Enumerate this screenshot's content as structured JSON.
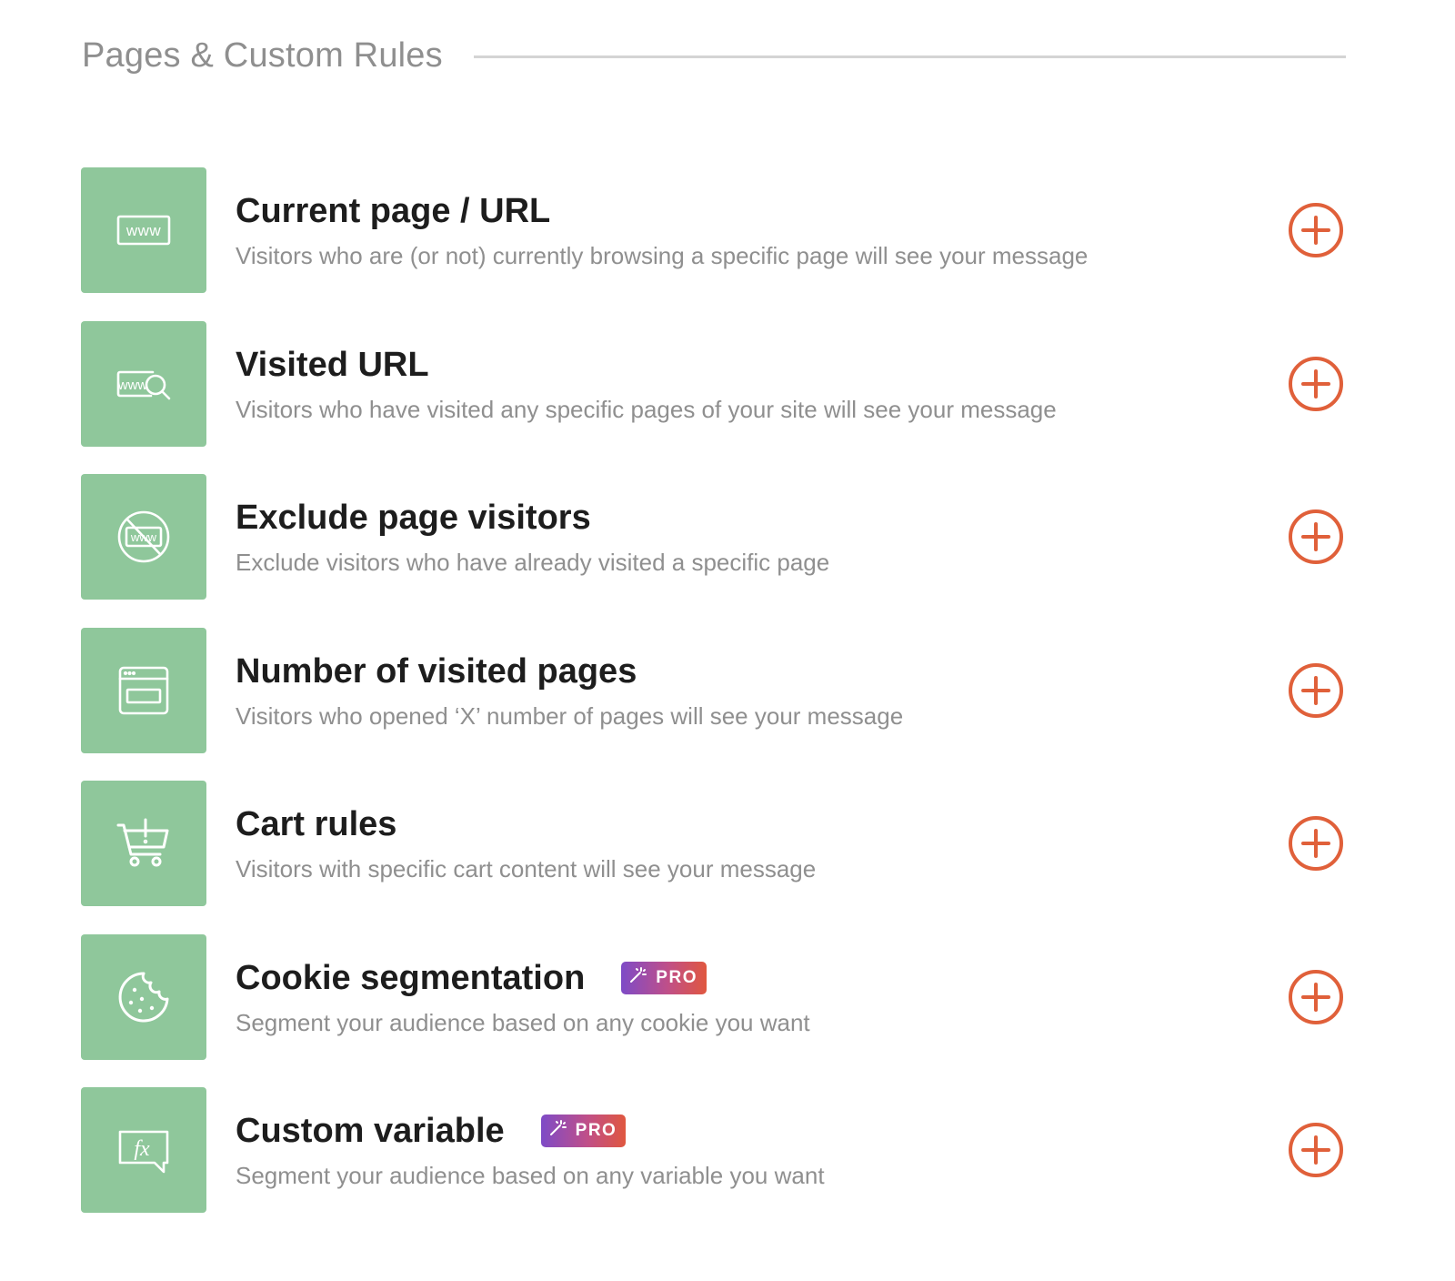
{
  "section": {
    "title": "Pages & Custom Rules"
  },
  "colors": {
    "icon_tile": "#8fc79b",
    "add_button": "#e0603a",
    "pro_badge_start": "#7e4bc7",
    "pro_badge_end": "#e0573f"
  },
  "rules": [
    {
      "title": "Current page / URL",
      "description": "Visitors who are (or not) currently browsing a specific page will see your message",
      "icon": "www-icon",
      "pro": false
    },
    {
      "title": "Visited URL",
      "description": "Visitors who have visited any specific pages of your site will see your message",
      "icon": "www-search-icon",
      "pro": false
    },
    {
      "title": "Exclude page visitors",
      "description": "Exclude visitors who have already visited a specific page",
      "icon": "www-blocked-icon",
      "pro": false
    },
    {
      "title": "Number of visited pages",
      "description": "Visitors who opened ‘X’ number of pages will see your message",
      "icon": "browser-window-icon",
      "pro": false
    },
    {
      "title": "Cart rules",
      "description": "Visitors with specific cart content will see your message",
      "icon": "cart-alert-icon",
      "pro": false
    },
    {
      "title": "Cookie segmentation",
      "description": "Segment your audience based on any cookie you want",
      "icon": "cookie-icon",
      "pro": true,
      "badge_label": "PRO"
    },
    {
      "title": "Custom variable",
      "description": "Segment your audience based on any variable you want",
      "icon": "function-bubble-icon",
      "pro": true,
      "badge_label": "PRO"
    }
  ]
}
